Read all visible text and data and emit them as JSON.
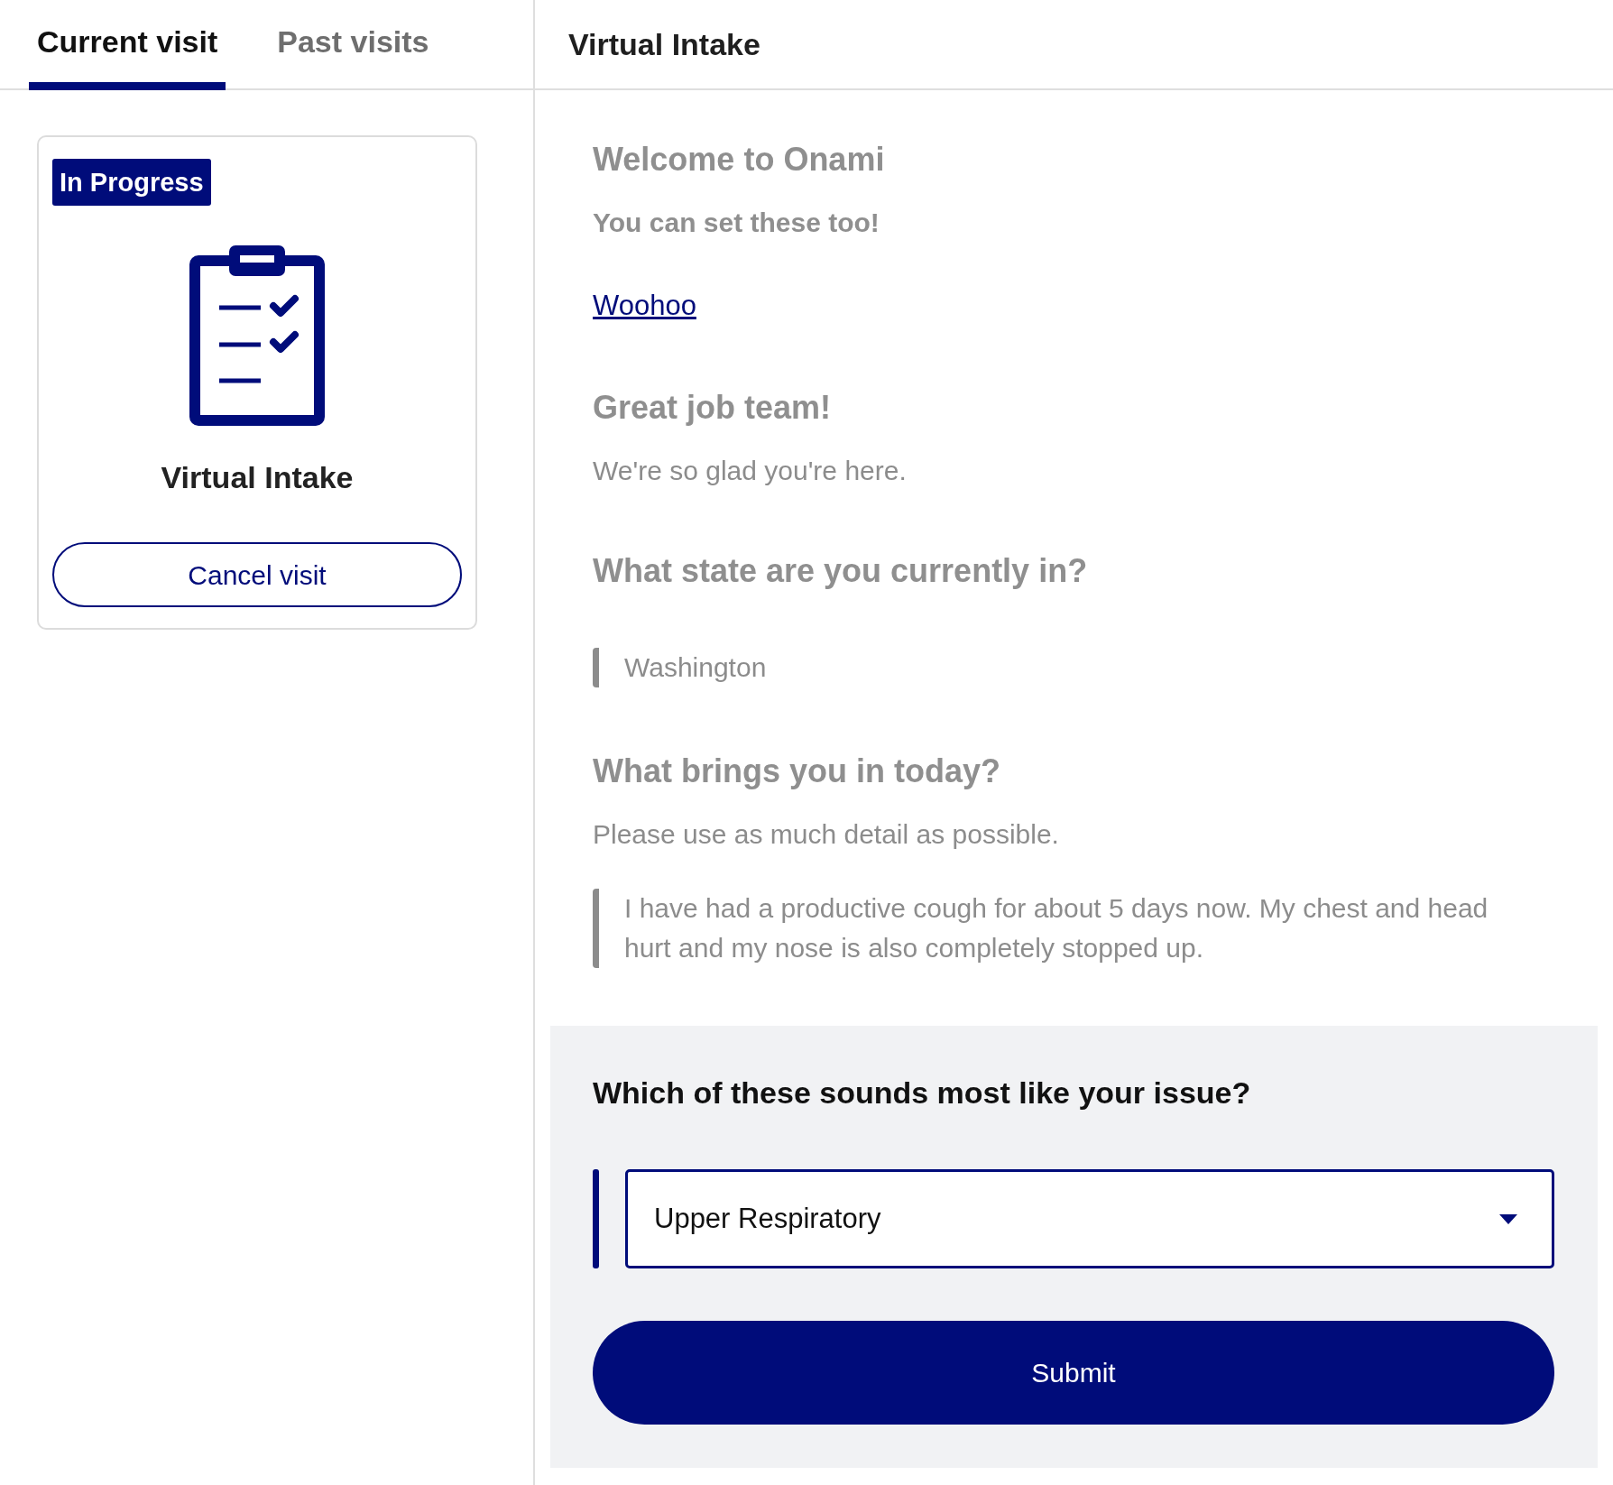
{
  "tabs": [
    {
      "label": "Current visit",
      "selected": true
    },
    {
      "label": "Past visits",
      "selected": false
    }
  ],
  "visit_card": {
    "status": "In Progress",
    "title": "Virtual Intake",
    "cancel_button": "Cancel visit"
  },
  "intake": {
    "title": "Virtual Intake",
    "blocks": [
      {
        "kind": "heading",
        "text": "Welcome to Onami"
      },
      {
        "kind": "subheading",
        "text": "You can set these too!"
      },
      {
        "kind": "link",
        "text": "Woohoo"
      },
      {
        "kind": "heading",
        "text": "Great job team!"
      },
      {
        "kind": "paragraph",
        "text": "We're so glad you're here."
      },
      {
        "kind": "heading",
        "text": "What state are you currently in?"
      },
      {
        "kind": "answer",
        "text": "Washington"
      },
      {
        "kind": "heading",
        "text": "What brings you in today?"
      },
      {
        "kind": "paragraph",
        "text": "Please use as much detail as possible."
      },
      {
        "kind": "answer",
        "text": "I have had a productive cough for about 5 days now. My chest and head hurt and my nose is also completely stopped up."
      }
    ]
  },
  "question": {
    "prompt": "Which of these sounds most like your issue?",
    "select_value": "Upper Respiratory",
    "submit_button": "Submit"
  }
}
